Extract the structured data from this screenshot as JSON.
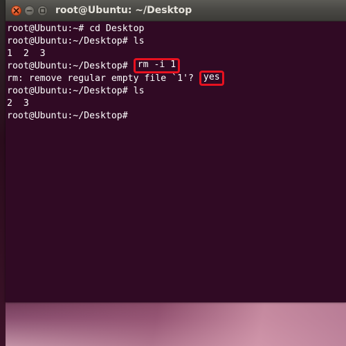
{
  "window": {
    "title": "root@Ubuntu: ~/Desktop",
    "buttons": {
      "close": "close-icon",
      "minimize": "minimize-icon",
      "maximize": "maximize-icon"
    }
  },
  "terminal": {
    "line1_prompt": "root@Ubuntu:~# ",
    "line1_command": "cd Desktop",
    "line2_prompt": "root@Ubuntu:~/Desktop# ",
    "line2_command": "ls",
    "line3_output": "1  2  3",
    "line4_prompt": "root@Ubuntu:~/Desktop# ",
    "line4_command": "rm -i 1",
    "line5_output": "rm: remove regular empty file `1'? ",
    "line5_answer": "yes",
    "line6_prompt": "root@Ubuntu:~/Desktop# ",
    "line6_command": "ls",
    "line7_output": "2  3",
    "line8_prompt": "root@Ubuntu:~/Desktop# "
  },
  "colors": {
    "terminal_bg": "#300a24",
    "text": "#ffffff",
    "highlight_box": "#e8111f",
    "titlebar": "#3c3b37",
    "close_button": "#e0592a"
  }
}
